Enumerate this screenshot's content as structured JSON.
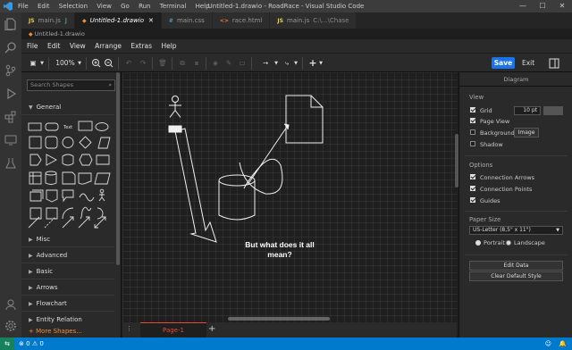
{
  "window": {
    "title": "Untitled-1.drawio - RoadRace - Visual Studio Code",
    "menu": [
      "File",
      "Edit",
      "Selection",
      "View",
      "Go",
      "Run",
      "Terminal",
      "Help"
    ]
  },
  "tabs": [
    {
      "icon": "JS",
      "label": "main.js",
      "modifier": "J"
    },
    {
      "icon": "",
      "label": "Untitled-1.drawio",
      "close": "✕",
      "active": true
    },
    {
      "icon": "#",
      "label": "main.css"
    },
    {
      "icon": "<>",
      "label": "race.html"
    },
    {
      "icon": "JS",
      "label": "main.js",
      "path": "C:\\...\\Chase"
    }
  ],
  "breadcrumb": "Untitled-1.drawio",
  "drawio_menu": [
    "File",
    "Edit",
    "View",
    "Arrange",
    "Extras",
    "Help"
  ],
  "toolbar": {
    "zoom": "100%",
    "save_label": "Save",
    "exit_label": "Exit"
  },
  "shapes_panel": {
    "search_placeholder": "Search Shapes",
    "general_label": "General",
    "text_shape": "Text",
    "sections": [
      "Misc",
      "Advanced",
      "Basic",
      "Arrows",
      "Flowchart",
      "Entity Relation"
    ],
    "more_shapes": "+ More Shapes..."
  },
  "canvas": {
    "label": "But what does it all mean?"
  },
  "pages": {
    "tab": "Page-1",
    "add": "+"
  },
  "format_panel": {
    "title": "Diagram",
    "view_header": "View",
    "grid_label": "Grid",
    "grid_size": "10 pt",
    "page_view_label": "Page View",
    "background_label": "Background",
    "image_button": "Image",
    "shadow_label": "Shadow",
    "options_header": "Options",
    "connection_arrows": "Connection Arrows",
    "connection_points": "Connection Points",
    "guides": "Guides",
    "paper_size_header": "Paper Size",
    "paper_size_value": "US-Letter (8,5\" x 11\")",
    "portrait": "Portrait",
    "landscape": "Landscape",
    "edit_data_button": "Edit Data",
    "clear_style_button": "Clear Default Style",
    "checks": {
      "grid": true,
      "page_view": true,
      "background": false,
      "shadow": false,
      "connection_arrows": true,
      "connection_points": true,
      "guides": true
    }
  },
  "status": {
    "errors": "0",
    "warnings": "0"
  },
  "colors": {
    "accent": "#007acc",
    "save": "#1a73e8",
    "page_tab": "#e8493a",
    "more_shapes": "#f08e3a"
  }
}
